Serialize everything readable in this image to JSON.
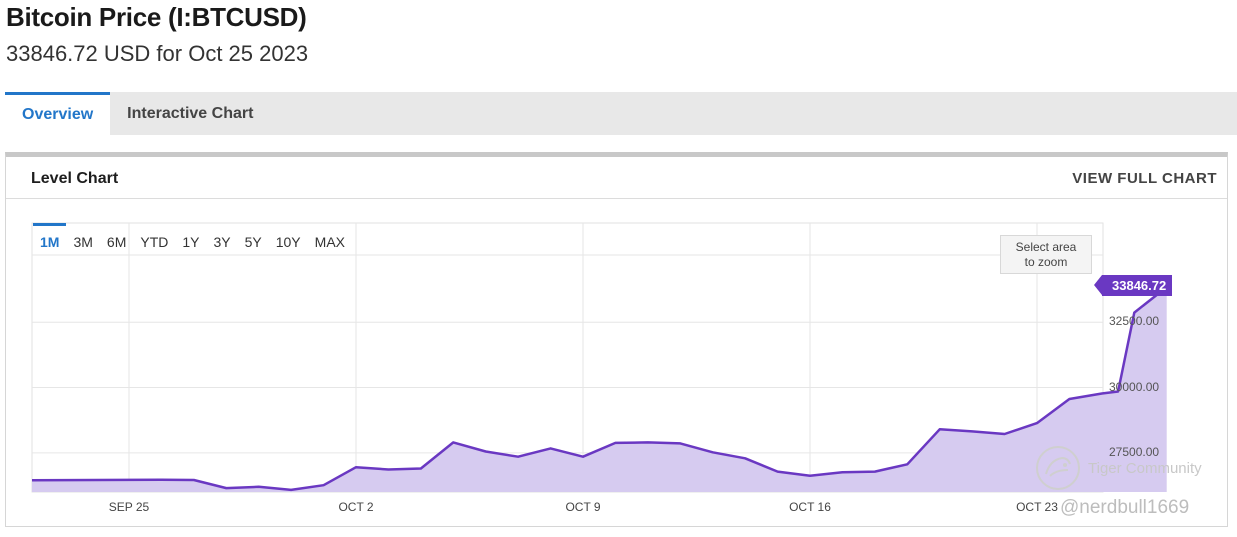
{
  "header": {
    "title": "Bitcoin Price (I:BTCUSD)",
    "subtitle": "33846.72 USD for Oct 25 2023"
  },
  "tabs": [
    {
      "label": "Overview",
      "active": true
    },
    {
      "label": "Interactive Chart",
      "active": false
    }
  ],
  "panel": {
    "title": "Level Chart",
    "full_chart_label": "VIEW FULL CHART"
  },
  "ranges": [
    "1M",
    "3M",
    "6M",
    "YTD",
    "1Y",
    "3Y",
    "5Y",
    "10Y",
    "MAX"
  ],
  "active_range": "1M",
  "zoom_hint_line1": "Select area",
  "zoom_hint_line2": "to zoom",
  "last_value_label": "33846.72",
  "watermark": {
    "brand": "Tiger Community",
    "handle": "@nerdbull1669"
  },
  "colors": {
    "line": "#6a38c2",
    "fill": "#d6cbf0",
    "accent": "#2276c9"
  },
  "chart_data": {
    "type": "area",
    "title": "Level Chart",
    "xlabel": "",
    "ylabel": "",
    "x_tick_labels": [
      "SEP 25",
      "OCT 2",
      "OCT 9",
      "OCT 16",
      "OCT 23"
    ],
    "x_tick_dates": [
      "2023-09-25",
      "2023-10-02",
      "2023-10-09",
      "2023-10-16",
      "2023-10-23"
    ],
    "y_tick_labels": [
      "27500.00",
      "30000.00",
      "32500.00"
    ],
    "y_ticks": [
      27500,
      30000,
      32500
    ],
    "xlim": [
      "2023-09-25",
      "2023-10-25"
    ],
    "ylim": [
      26000,
      36300
    ],
    "grid": true,
    "series": [
      {
        "values": [
          {
            "x": "2023-09-25",
            "y": 26450
          },
          {
            "x": "2023-09-26",
            "y": 26470
          },
          {
            "x": "2023-09-27",
            "y": 26460
          },
          {
            "x": "2023-09-28",
            "y": 26150
          },
          {
            "x": "2023-09-29",
            "y": 26200
          },
          {
            "x": "2023-09-30",
            "y": 26080
          },
          {
            "x": "2023-10-01",
            "y": 26260
          },
          {
            "x": "2023-10-02",
            "y": 26950
          },
          {
            "x": "2023-10-03",
            "y": 26860
          },
          {
            "x": "2023-10-04",
            "y": 26900
          },
          {
            "x": "2023-10-05",
            "y": 27900
          },
          {
            "x": "2023-10-06",
            "y": 27550
          },
          {
            "x": "2023-10-07",
            "y": 27350
          },
          {
            "x": "2023-10-08",
            "y": 27670
          },
          {
            "x": "2023-10-09",
            "y": 27350
          },
          {
            "x": "2023-10-10",
            "y": 27880
          },
          {
            "x": "2023-10-11",
            "y": 27900
          },
          {
            "x": "2023-10-12",
            "y": 27860
          },
          {
            "x": "2023-10-13",
            "y": 27520
          },
          {
            "x": "2023-10-14",
            "y": 27290
          },
          {
            "x": "2023-10-15",
            "y": 26780
          },
          {
            "x": "2023-10-16",
            "y": 26620
          },
          {
            "x": "2023-10-17",
            "y": 26760
          },
          {
            "x": "2023-10-18",
            "y": 26780
          },
          {
            "x": "2023-10-19",
            "y": 27060
          },
          {
            "x": "2023-10-20",
            "y": 28400
          },
          {
            "x": "2023-10-21",
            "y": 28320
          },
          {
            "x": "2023-10-22",
            "y": 28220
          },
          {
            "x": "2023-10-23",
            "y": 28640
          },
          {
            "x": "2023-10-24",
            "y": 29560
          },
          {
            "x": "2023-10-25",
            "y": 29770
          },
          {
            "x": "2023-10-25T12:00",
            "y": 29850
          },
          {
            "x": "2023-10-26",
            "y": 32870
          },
          {
            "x": "2023-10-27",
            "y": 33846.72
          }
        ]
      }
    ]
  }
}
